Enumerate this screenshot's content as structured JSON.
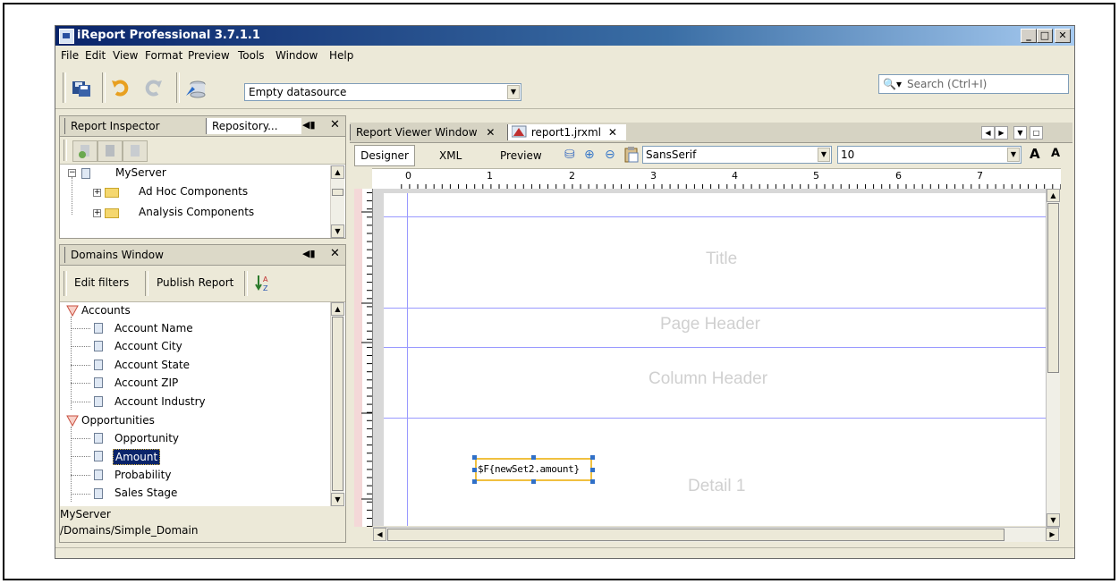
{
  "window": {
    "title": "iReport Professional 3.7.1.1"
  },
  "menu": [
    "File",
    "Edit",
    "View",
    "Format",
    "Preview",
    "Tools",
    "Window",
    "Help"
  ],
  "toolbar": {
    "datasource": "Empty datasource",
    "search_placeholder": "Search (Ctrl+I)"
  },
  "left_panel": {
    "tabs": [
      "Report Inspector",
      "Repository..."
    ],
    "server_tree": [
      "MyServer",
      "Ad Hoc Components",
      "Analysis Components"
    ]
  },
  "domains": {
    "title": "Domains Window",
    "buttons": {
      "edit_filters": "Edit filters",
      "publish": "Publish Report"
    },
    "groups": [
      {
        "name": "Accounts",
        "items": [
          "Account Name",
          "Account City",
          "Account State",
          "Account ZIP",
          "Account Industry"
        ]
      },
      {
        "name": "Opportunities",
        "items": [
          "Opportunity",
          "Amount",
          "Probability",
          "Sales Stage"
        ]
      }
    ],
    "selected": "Amount",
    "status": [
      "MyServer",
      "/Domains/Simple_Domain"
    ]
  },
  "editor": {
    "tabs": [
      "Report Viewer Window",
      "report1.jrxml"
    ],
    "modes": [
      "Designer",
      "XML",
      "Preview"
    ],
    "font": "SansSerif",
    "size": "10",
    "ruler": [
      "0",
      "1",
      "2",
      "3",
      "4",
      "5",
      "6",
      "7"
    ],
    "bands": [
      "Title",
      "Page Header",
      "Column Header",
      "Detail 1"
    ],
    "field": "$F{newSet2.amount}"
  }
}
